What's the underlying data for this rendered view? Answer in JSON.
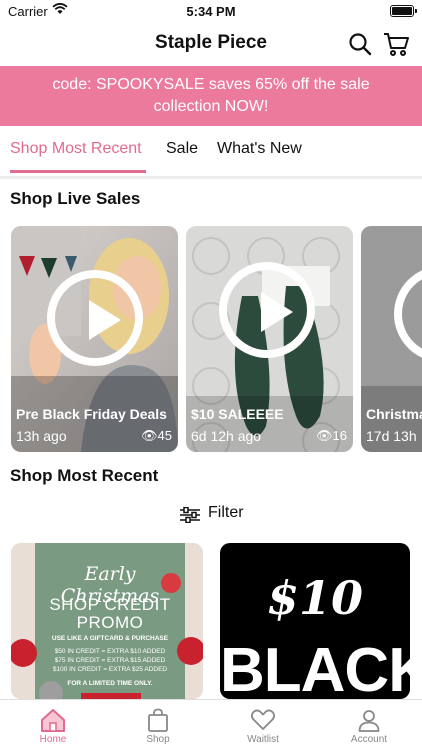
{
  "status": {
    "carrier": "Carrier",
    "time": "5:34 PM"
  },
  "header": {
    "title": "Staple Piece"
  },
  "banner": {
    "line1": "code: SPOOKYSALE saves 65% off the sale",
    "line2": "collection NOW!"
  },
  "tabs": [
    {
      "label": "Shop Most Recent"
    },
    {
      "label": "Sale"
    },
    {
      "label": "What's New"
    }
  ],
  "live_sales": {
    "title": "Shop Live Sales",
    "cards": [
      {
        "title": "Pre Black Friday Deals",
        "time": "13h ago",
        "views": "45"
      },
      {
        "title": "$10 SALEEEE",
        "time": "6d 12h ago",
        "views": "16"
      },
      {
        "title": "Christma",
        "time": "17d 13h"
      }
    ]
  },
  "most_recent": {
    "title": "Shop Most Recent",
    "filter_label": "Filter",
    "cards": [
      {
        "heading": "Early Christmas",
        "promo1": "SHOP CREDIT",
        "promo2": "PROMO",
        "sub": "USE LIKE A GIFTCARD & PURCHASE",
        "r1": "$50 IN CREDIT = EXTRA $10 ADDED",
        "r2": "$75 IN CREDIT = EXTRA $15 ADDED",
        "r3": "$100 IN CREDIT = EXTRA $25 ADDED",
        "limited": "FOR A LIMITED TIME ONLY."
      },
      {
        "line1": "$10",
        "line2": "BLACK"
      }
    ]
  },
  "tabbar": [
    {
      "label": "Home"
    },
    {
      "label": "Shop"
    },
    {
      "label": "Waitlist"
    },
    {
      "label": "Account"
    }
  ],
  "colors": {
    "accent": "#e06b8e",
    "banner": "#ec7a9c"
  }
}
